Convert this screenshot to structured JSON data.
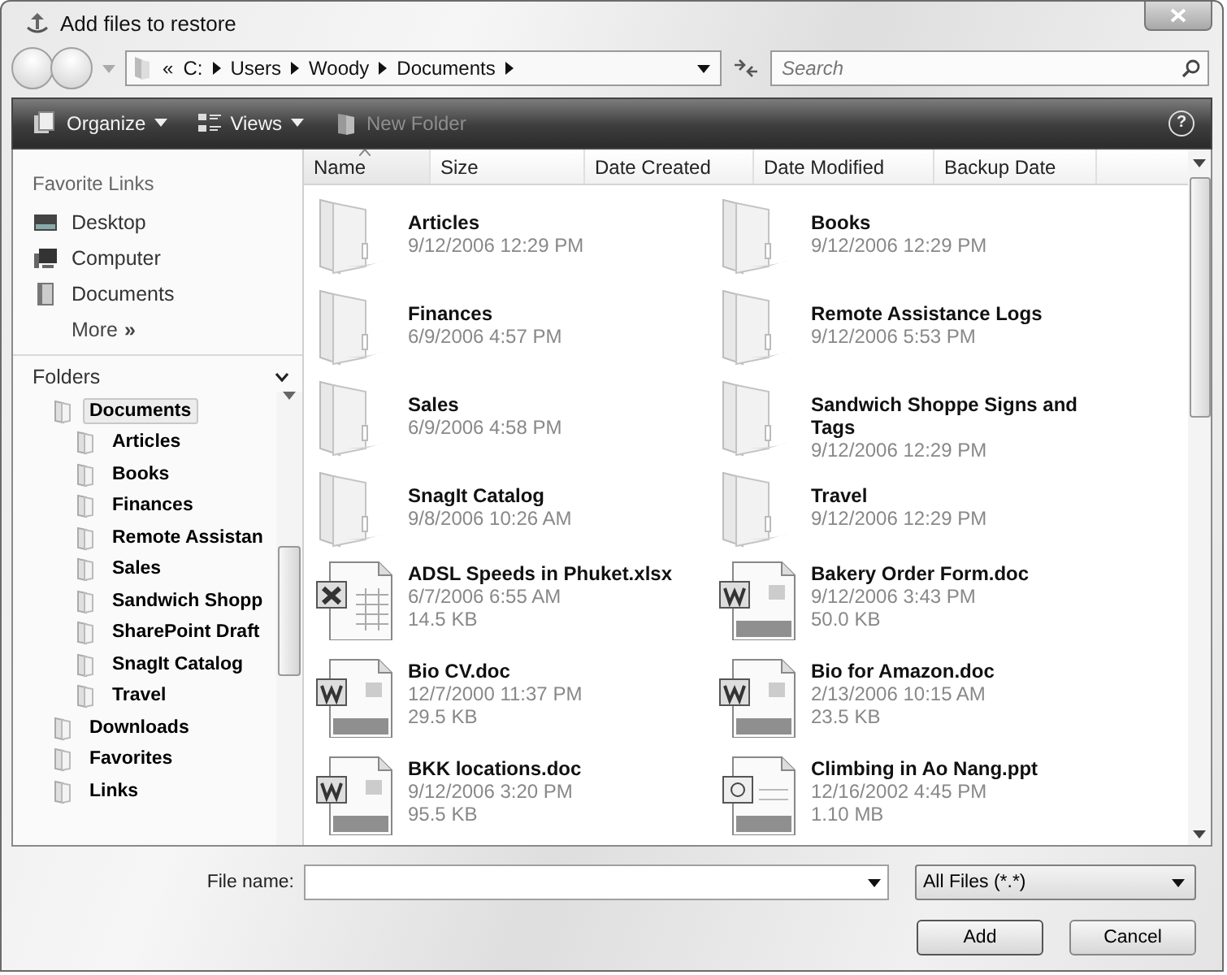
{
  "window": {
    "title": "Add files to restore"
  },
  "address": {
    "overflow": "«",
    "crumbs": [
      "C:",
      "Users",
      "Woody",
      "Documents"
    ],
    "search_placeholder": "Search"
  },
  "toolbar": {
    "items": [
      {
        "label": "Organize",
        "kind": "organize",
        "disabled": false
      },
      {
        "label": "Views",
        "kind": "views",
        "disabled": false
      },
      {
        "label": "New Folder",
        "kind": "newfolder",
        "disabled": true
      }
    ],
    "help": "?"
  },
  "favorite_links": {
    "title": "Favorite Links",
    "items": [
      {
        "label": "Desktop",
        "kind": "desktop"
      },
      {
        "label": "Computer",
        "kind": "computer"
      },
      {
        "label": "Documents",
        "kind": "documents"
      }
    ],
    "more": "More",
    "more_mark": "»"
  },
  "folders": {
    "title": "Folders",
    "tree": [
      {
        "label": "Documents",
        "selected": true,
        "children": [
          {
            "label": "Articles",
            "selected": false
          },
          {
            "label": "Books",
            "selected": false
          },
          {
            "label": "Finances",
            "selected": false
          },
          {
            "label": "Remote Assistan",
            "selected": false
          },
          {
            "label": "Sales",
            "selected": false
          },
          {
            "label": "Sandwich Shopp",
            "selected": false
          },
          {
            "label": "SharePoint Draft",
            "selected": false
          },
          {
            "label": "SnagIt Catalog",
            "selected": false
          },
          {
            "label": "Travel",
            "selected": false
          }
        ]
      },
      {
        "label": "Downloads",
        "selected": false
      },
      {
        "label": "Favorites",
        "selected": false
      },
      {
        "label": "Links",
        "selected": false
      }
    ]
  },
  "columns": [
    {
      "label": "Name",
      "sorted": true
    },
    {
      "label": "Size",
      "sorted": false
    },
    {
      "label": "Date Created",
      "sorted": false
    },
    {
      "label": "Date Modified",
      "sorted": false
    },
    {
      "label": "Backup Date",
      "sorted": false
    }
  ],
  "items": [
    {
      "kind": "folder",
      "name": "Articles",
      "date": "9/12/2006 12:29 PM"
    },
    {
      "kind": "folder",
      "name": "Books",
      "date": "9/12/2006 12:29 PM"
    },
    {
      "kind": "folder",
      "name": "Finances",
      "date": "6/9/2006 4:57 PM"
    },
    {
      "kind": "folder",
      "name": "Remote Assistance Logs",
      "date": "9/12/2006 5:53 PM"
    },
    {
      "kind": "folder",
      "name": "Sales",
      "date": "6/9/2006 4:58 PM"
    },
    {
      "kind": "folder",
      "name": "Sandwich Shoppe Signs and Tags",
      "date": "9/12/2006 12:29 PM"
    },
    {
      "kind": "folder",
      "name": "SnagIt Catalog",
      "date": "9/8/2006 10:26 AM"
    },
    {
      "kind": "folder",
      "name": "Travel",
      "date": "9/12/2006 12:29 PM"
    },
    {
      "kind": "spreadsheet",
      "name": "ADSL Speeds in Phuket.xlsx",
      "date": "6/7/2006 6:55 AM",
      "size": "14.5 KB"
    },
    {
      "kind": "document",
      "name": "Bakery Order Form.doc",
      "date": "9/12/2006 3:43 PM",
      "size": "50.0 KB"
    },
    {
      "kind": "document",
      "name": "Bio CV.doc",
      "date": "12/7/2000 11:37 PM",
      "size": "29.5 KB"
    },
    {
      "kind": "document",
      "name": "Bio for Amazon.doc",
      "date": "2/13/2006 10:15 AM",
      "size": "23.5 KB"
    },
    {
      "kind": "document",
      "name": "BKK locations.doc",
      "date": "9/12/2006 3:20 PM",
      "size": "95.5 KB"
    },
    {
      "kind": "presentation",
      "name": "Climbing in Ao Nang.ppt",
      "date": "12/16/2002 4:45 PM",
      "size": "1.10 MB"
    }
  ],
  "file_name": {
    "label": "File name:"
  },
  "filter": {
    "value": "All Files (*.*)"
  },
  "buttons": [
    {
      "label": "Add",
      "default": true
    },
    {
      "label": "Cancel",
      "default": false
    }
  ]
}
